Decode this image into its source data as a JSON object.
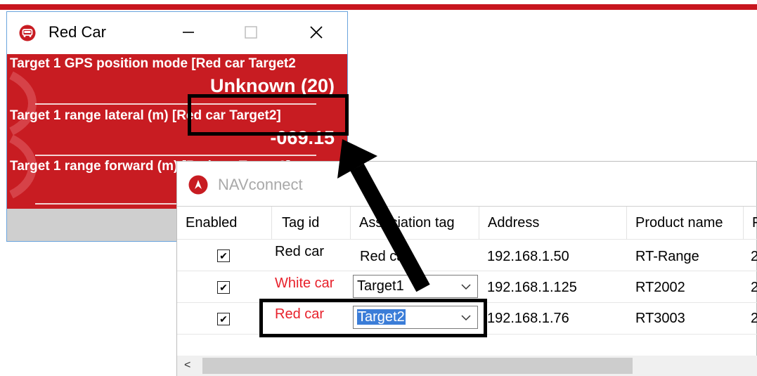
{
  "red_car_window": {
    "title": "Red Car",
    "min_glyph": "—",
    "max_glyph": "☐",
    "close_glyph": "✕",
    "labels": [
      "Target 1 GPS position mode [Red car Target2",
      "Target 1 range lateral (m) [Red car Target2]",
      "Target 1 range forward (m) [Red car Target2]"
    ],
    "values": [
      "Unknown (20)",
      "-069.15"
    ]
  },
  "nav_window": {
    "title": "NAVconnect",
    "columns": [
      "Enabled",
      "Tag id",
      "Association tag",
      "Address",
      "Product name",
      "F"
    ],
    "rows": [
      {
        "enabled": true,
        "check": "✔",
        "tag_id": "Red car",
        "association": "Red car",
        "address": "192.168.1.50",
        "product": "RT-Range",
        "extra": "2"
      },
      {
        "enabled": true,
        "check": "✔",
        "tag_id": "White car",
        "association": "Target1",
        "address": "192.168.1.125",
        "product": "RT2002",
        "extra": "2"
      },
      {
        "enabled": true,
        "check": "✔",
        "tag_id": "Red car",
        "association": "Target2",
        "address": "192.168.1.76",
        "product": "RT3003",
        "extra": "2"
      }
    ],
    "scroll_left": "<"
  },
  "colors": {
    "brand_red": "#c81c22",
    "accent_blue": "#3b7dd8",
    "tag_red": "#e8212b"
  }
}
